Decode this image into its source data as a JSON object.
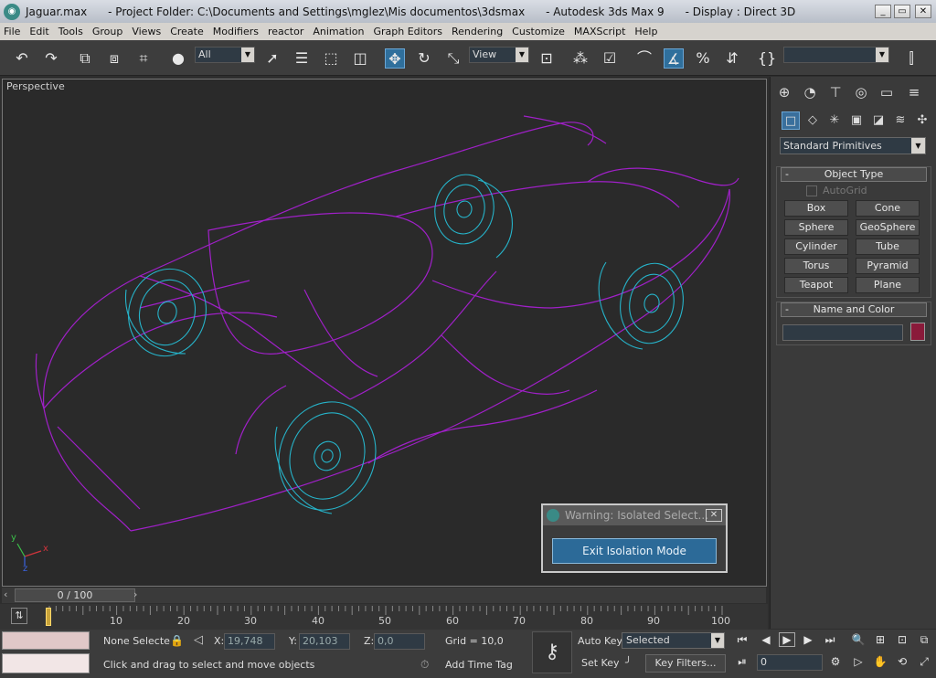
{
  "window": {
    "title": "Jaguar.max      - Project Folder: C:\\Documents and Settings\\mglez\\Mis documentos\\3dsmax      - Autodesk 3ds Max 9      - Display : Direct 3D",
    "min": "_",
    "max": "▭",
    "close": "✕"
  },
  "menu": [
    "File",
    "Edit",
    "Tools",
    "Group",
    "Views",
    "Create",
    "Modifiers",
    "reactor",
    "Animation",
    "Graph Editors",
    "Rendering",
    "Customize",
    "MAXScript",
    "Help"
  ],
  "toolbar": {
    "selection_filter": "All",
    "ref_coord": "View",
    "named_selection": ""
  },
  "viewport": {
    "label": "Perspective",
    "axis_x": "x",
    "axis_y": "y",
    "axis_z": "z",
    "colors": {
      "body": "#a020c8",
      "wheels": "#26b3c9"
    }
  },
  "command_panel": {
    "category": "Standard Primitives",
    "object_type_title": "Object Type",
    "autogrid": "AutoGrid",
    "primitives": [
      "Box",
      "Cone",
      "Sphere",
      "GeoSphere",
      "Cylinder",
      "Tube",
      "Torus",
      "Pyramid",
      "Teapot",
      "Plane"
    ],
    "name_color_title": "Name and Color",
    "object_name": "",
    "object_color": "#8a1a3a"
  },
  "warning": {
    "title": "Warning: Isolated Select...",
    "exit_button": "Exit Isolation Mode"
  },
  "time": {
    "frame": "0 / 100",
    "ticks": [
      "10",
      "20",
      "30",
      "40",
      "50",
      "60",
      "70",
      "80",
      "90",
      "100"
    ]
  },
  "status": {
    "selection": "None Selecte",
    "x_label": "X:",
    "x_value": "19,748",
    "y_label": "Y:",
    "y_value": "20,103",
    "z_label": "Z:",
    "z_value": "0,0",
    "grid": "Grid = 10,0",
    "prompt": "Click and drag to select and move objects",
    "add_time_tag": "Add Time Tag",
    "auto_key": "Auto Key",
    "set_key": "Set Key",
    "key_mode": "Selected",
    "key_filters": "Key Filters...",
    "current_frame": "0"
  }
}
